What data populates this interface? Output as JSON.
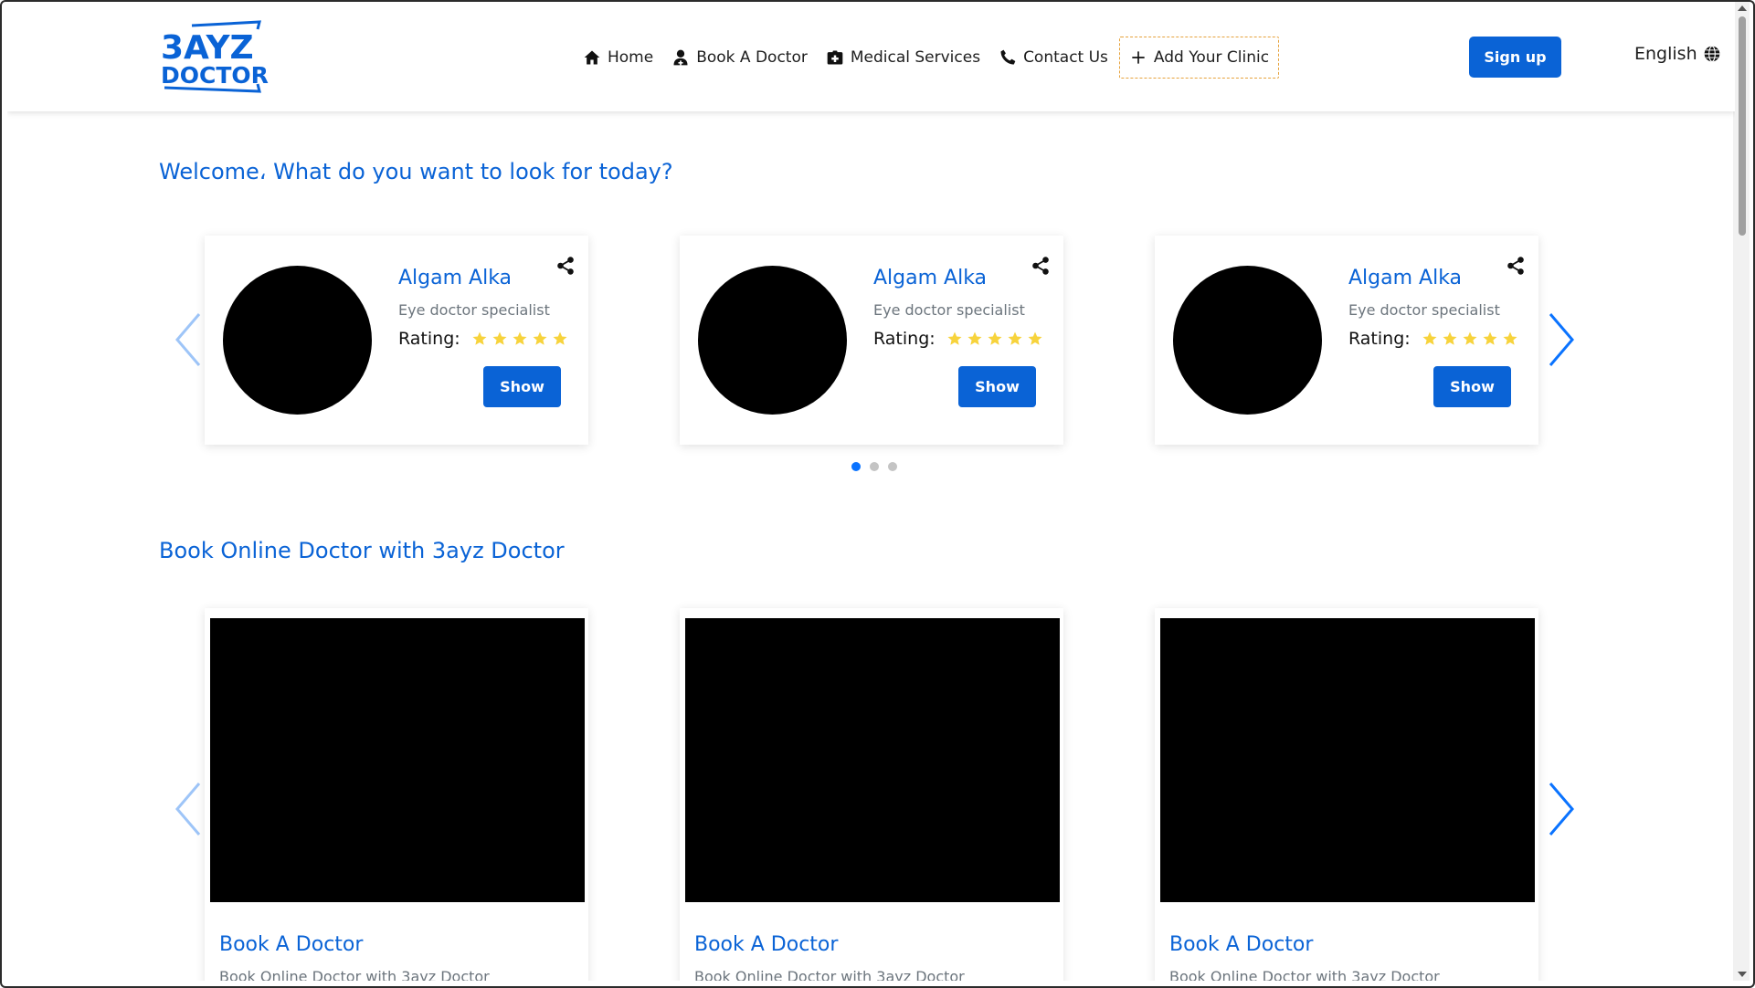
{
  "header": {
    "logo_line1": "3AYZ",
    "logo_line2": "DOCTOR",
    "nav": [
      {
        "label": "Home",
        "icon": "home-icon"
      },
      {
        "label": "Book A Doctor",
        "icon": "user-doctor-icon"
      },
      {
        "label": "Medical Services",
        "icon": "medical-kit-icon"
      },
      {
        "label": "Contact Us",
        "icon": "phone-icon"
      },
      {
        "label": "Add Your Clinic",
        "icon": "plus-icon"
      }
    ],
    "signup_label": "Sign up",
    "language_label": "English"
  },
  "welcome_title": "Welcome، What do you want to look for today?",
  "doctors": [
    {
      "name": "Algam Alka",
      "specialty": "Eye doctor specialist",
      "rating_label": "Rating:",
      "rating": 5,
      "show_label": "Show"
    },
    {
      "name": "Algam Alka",
      "specialty": "Eye doctor specialist",
      "rating_label": "Rating:",
      "rating": 5,
      "show_label": "Show"
    },
    {
      "name": "Algam Alka",
      "specialty": "Eye doctor specialist",
      "rating_label": "Rating:",
      "rating": 5,
      "show_label": "Show"
    }
  ],
  "carousel_dots": {
    "count": 3,
    "active": 0
  },
  "book_section_title": "Book Online Doctor with 3ayz Doctor",
  "services": [
    {
      "title": "Book A Doctor",
      "description": "Book Online Doctor with 3ayz Doctor"
    },
    {
      "title": "Book A Doctor",
      "description": "Book Online Doctor with 3ayz Doctor"
    },
    {
      "title": "Book A Doctor",
      "description": "Book Online Doctor with 3ayz Doctor"
    }
  ],
  "colors": {
    "primary": "#0a63d6",
    "star": "#f7d33c",
    "arrow": "#0a73ff",
    "arrow_disabled": "#9ec5f8",
    "clinic_border": "#e6a23c"
  }
}
